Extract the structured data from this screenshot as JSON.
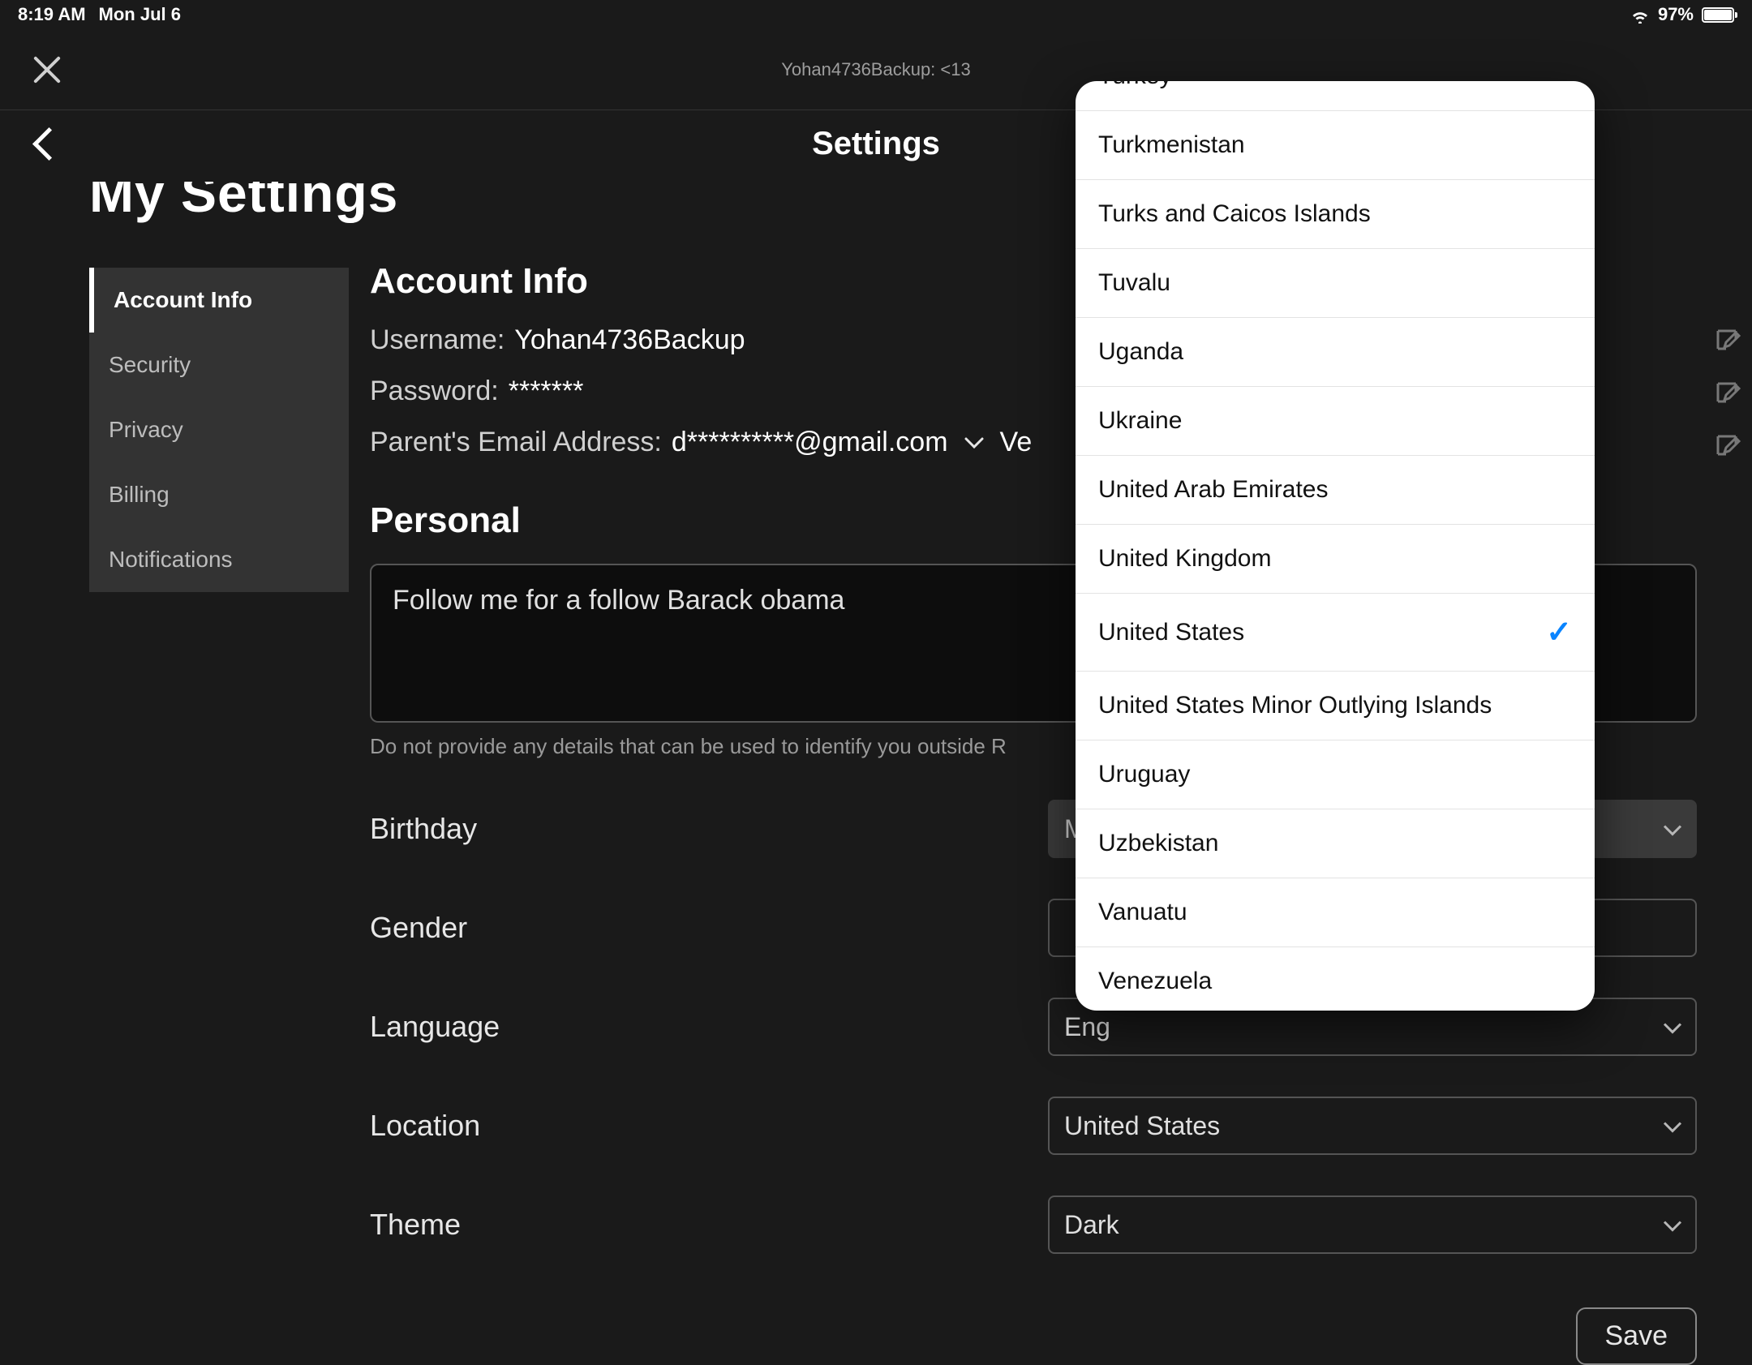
{
  "status": {
    "time": "8:19 AM",
    "date": "Mon Jul 6",
    "battery": "97%"
  },
  "appbar": {
    "subtitle": "Yohan4736Backup: <13"
  },
  "settings_title": "Settings",
  "big_title": "My Settings",
  "sidebar": {
    "items": [
      {
        "label": "Account Info",
        "active": true
      },
      {
        "label": "Security"
      },
      {
        "label": "Privacy"
      },
      {
        "label": "Billing"
      },
      {
        "label": "Notifications"
      }
    ]
  },
  "account": {
    "heading": "Account Info",
    "username_label": "Username:",
    "username_value": "Yohan4736Backup",
    "password_label": "Password:",
    "password_value": "*******",
    "parent_email_label": "Parent's Email Address:",
    "parent_email_value": "d**********@gmail.com",
    "verified_text": "Ve"
  },
  "personal": {
    "heading": "Personal",
    "bio": "Follow me for a follow Barack obama",
    "help": "Do not provide any details that can be used to identify you outside R",
    "birthday_label": "Birthday",
    "birthday_value_partial": "Ma",
    "gender_label": "Gender",
    "gender_value": "",
    "language_label": "Language",
    "language_value_partial": "Eng",
    "location_label": "Location",
    "location_value": "United States",
    "theme_label": "Theme",
    "theme_value": "Dark"
  },
  "save_label": "Save",
  "popover": {
    "selected": "United States",
    "items": [
      "Turkey",
      "Turkmenistan",
      "Turks and Caicos Islands",
      "Tuvalu",
      "Uganda",
      "Ukraine",
      "United Arab Emirates",
      "United Kingdom",
      "United States",
      "United States Minor Outlying Islands",
      "Uruguay",
      "Uzbekistan",
      "Vanuatu",
      "Venezuela"
    ]
  }
}
